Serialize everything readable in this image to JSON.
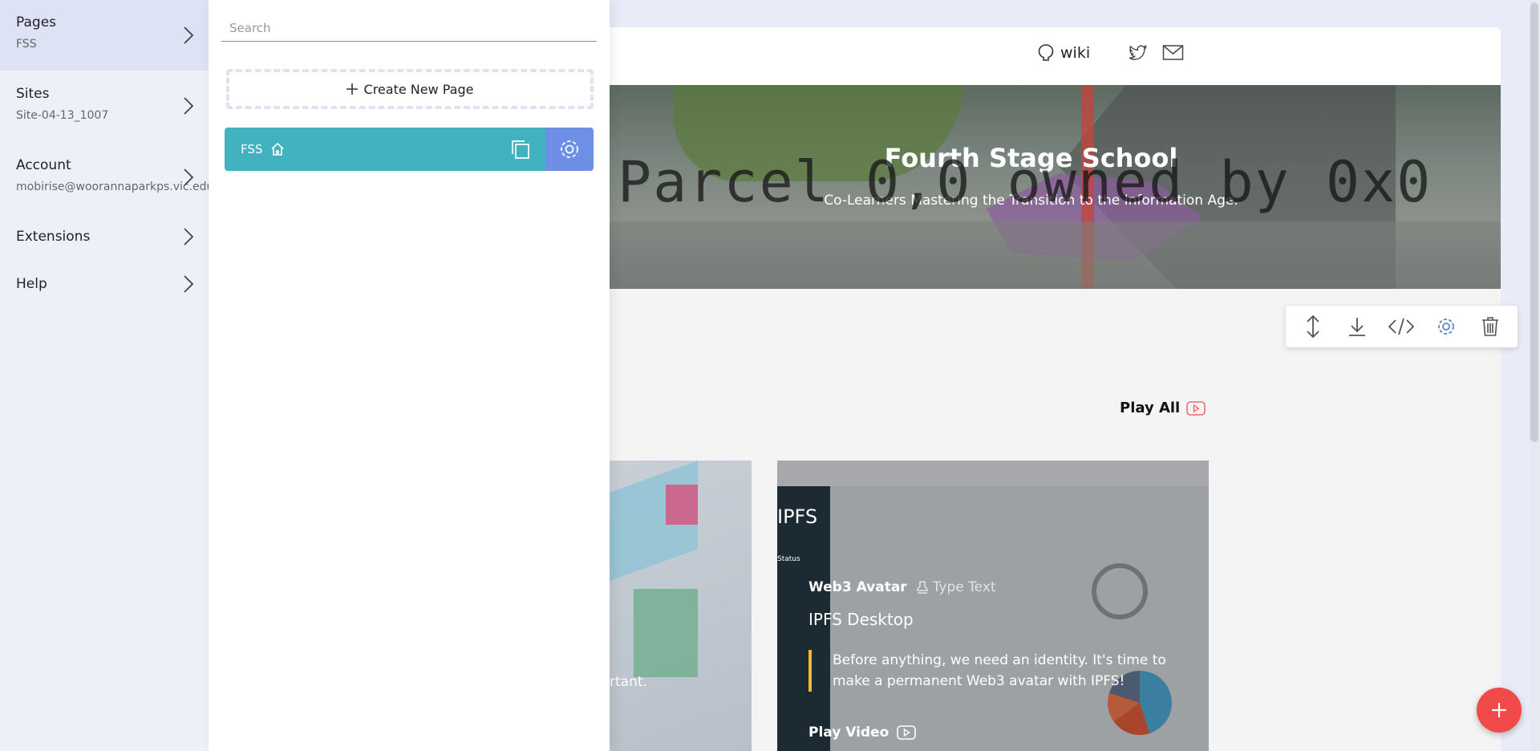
{
  "sidebar": {
    "items": [
      {
        "label": "Pages",
        "sub": "FSS"
      },
      {
        "label": "Sites",
        "sub": "Site-04-13_1007"
      },
      {
        "label": "Account",
        "sub": "mobirise@woorannaparkps.vic.edu."
      },
      {
        "label": "Extensions",
        "sub": ""
      },
      {
        "label": "Help",
        "sub": ""
      }
    ]
  },
  "pages_panel": {
    "search_placeholder": "Search",
    "create_label": "Create New Page",
    "pages": [
      {
        "name": "FSS",
        "is_home": true
      }
    ]
  },
  "site": {
    "nav": {
      "wiki_label": "wiki"
    },
    "hero": {
      "title": "Fourth Stage School",
      "subtitle": "Co-Learners Mastering the Transition to the Information Age.",
      "overlay_text": "Parcel 0,0 owned by 0x0"
    },
    "play_all_label": "Play All",
    "card_left": {
      "text_fragment": "rtant."
    },
    "card_right": {
      "screenshot_brand": "IPFS",
      "screenshot_status": "Status",
      "title": "Web3 Avatar",
      "type_text": "Type Text",
      "subtitle": "IPFS Desktop",
      "quote": "Before anything, we need an identity. It's time to make a permanent Web3 avatar with IPFS!",
      "play_video_label": "Play Video"
    }
  },
  "colors": {
    "accent_teal": "#42b2c0",
    "accent_blue": "#6e8fe6",
    "fab_red": "#f24a4a",
    "quote_bar": "#f5b82e"
  }
}
